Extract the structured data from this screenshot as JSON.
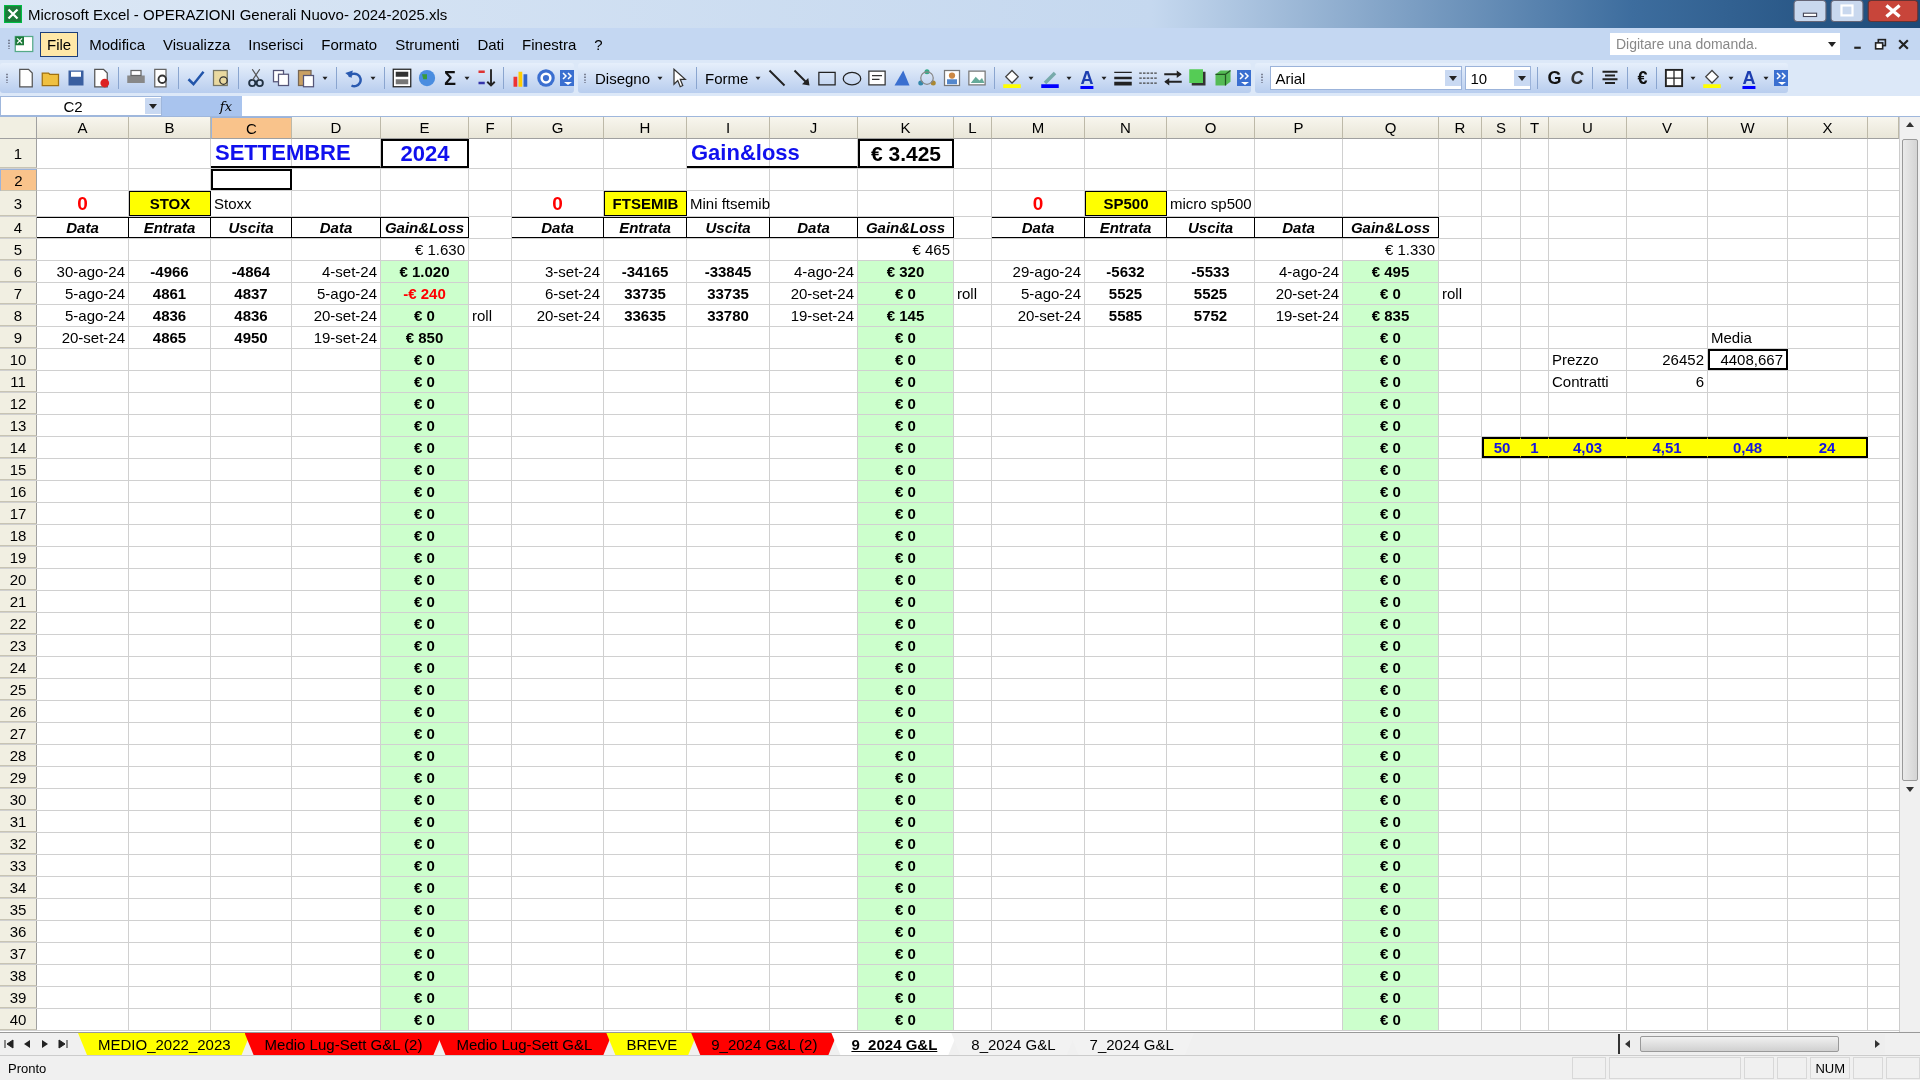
{
  "window": {
    "title": "Microsoft Excel - OPERAZIONI Generali Nuovo- 2024-2025.xls"
  },
  "menu": [
    {
      "label": "File",
      "selected": true
    },
    {
      "label": "Modifica",
      "selected": false
    },
    {
      "label": "Visualizza",
      "selected": false
    },
    {
      "label": "Inserisci",
      "selected": false
    },
    {
      "label": "Formato",
      "selected": false
    },
    {
      "label": "Strumenti",
      "selected": false
    },
    {
      "label": "Dati",
      "selected": false
    },
    {
      "label": "Finestra",
      "selected": false
    },
    {
      "label": "?",
      "selected": false
    }
  ],
  "help_search": {
    "placeholder": "Digitare una domanda."
  },
  "toolbar": {
    "sum": "Σ",
    "drawing": "Disegno",
    "shapes": "Forme",
    "drawing_font_color": "A",
    "font": "Arial",
    "size": "10",
    "bold": "G",
    "italic": "C",
    "euro": "€",
    "font_color": "A"
  },
  "formula_bar": {
    "name_box": "C2",
    "fx": "fx"
  },
  "sheet": {
    "columns": [
      {
        "label": "A",
        "selected": false
      },
      {
        "label": "B",
        "selected": false
      },
      {
        "label": "C",
        "selected": true
      },
      {
        "label": "D",
        "selected": false
      },
      {
        "label": "E",
        "selected": false
      },
      {
        "label": "F",
        "selected": false
      },
      {
        "label": "G",
        "selected": false
      },
      {
        "label": "H",
        "selected": false
      },
      {
        "label": "I",
        "selected": false
      },
      {
        "label": "J",
        "selected": false
      },
      {
        "label": "K",
        "selected": false
      },
      {
        "label": "L",
        "selected": false
      },
      {
        "label": "M",
        "selected": false
      },
      {
        "label": "N",
        "selected": false
      },
      {
        "label": "O",
        "selected": false
      },
      {
        "label": "P",
        "selected": false
      },
      {
        "label": "Q",
        "selected": false
      },
      {
        "label": "R",
        "selected": false
      },
      {
        "label": "S",
        "selected": false
      },
      {
        "label": "T",
        "selected": false
      },
      {
        "label": "U",
        "selected": false
      },
      {
        "label": "V",
        "selected": false
      },
      {
        "label": "W",
        "selected": false
      },
      {
        "label": "X",
        "selected": false
      }
    ],
    "rows": [
      {
        "n": "1",
        "selected": false,
        "cells": [
          {},
          {},
          {
            "kind": "title",
            "text": "SETTEMBRE"
          },
          {},
          {
            "kind": "year",
            "text": "2024"
          },
          {},
          {},
          {},
          {
            "kind": "title",
            "text": "Gain&loss"
          },
          {},
          {
            "kind": "grand-total",
            "text": "€ 3.425"
          }
        ]
      },
      {
        "n": "2",
        "selected": true,
        "cells": []
      },
      {
        "n": "3",
        "selected": false,
        "cells": [
          {
            "kind": "count",
            "text": "0"
          },
          {
            "kind": "ticker",
            "text": "STOX"
          },
          {
            "kind": "label",
            "text": "Stoxx"
          },
          {},
          {},
          {},
          {
            "kind": "count",
            "text": "0"
          },
          {
            "kind": "ticker",
            "text": "FTSEMIB"
          },
          {
            "kind": "label",
            "text": "Mini ftsemib"
          },
          {},
          {},
          {},
          {
            "kind": "count",
            "text": "0"
          },
          {
            "kind": "ticker",
            "text": "SP500"
          },
          {
            "kind": "label",
            "text": "micro sp500"
          }
        ]
      },
      {
        "n": "4",
        "selected": false,
        "cells": [
          {
            "kind": "col-head",
            "text": "Data"
          },
          {
            "kind": "col-head",
            "text": "Entrata"
          },
          {
            "kind": "col-head",
            "text": "Uscita"
          },
          {
            "kind": "col-head",
            "text": "Data"
          },
          {
            "kind": "col-head",
            "text": "Gain&Loss"
          },
          {},
          {
            "kind": "col-head",
            "text": "Data"
          },
          {
            "kind": "col-head",
            "text": "Entrata"
          },
          {
            "kind": "col-head",
            "text": "Uscita"
          },
          {
            "kind": "col-head",
            "text": "Data"
          },
          {
            "kind": "col-head",
            "text": "Gain&Loss"
          },
          {},
          {
            "kind": "col-head",
            "text": "Data"
          },
          {
            "kind": "col-head",
            "text": "Entrata"
          },
          {
            "kind": "col-head",
            "text": "Uscita"
          },
          {
            "kind": "col-head",
            "text": "Data"
          },
          {
            "kind": "col-head",
            "text": "Gain&Loss"
          }
        ]
      },
      {
        "n": "5",
        "selected": false,
        "cells": [
          {},
          {},
          {},
          {},
          {
            "kind": "sum",
            "text": "€ 1.630"
          },
          {},
          {},
          {},
          {},
          {},
          {
            "kind": "sum",
            "text": "€ 465"
          },
          {},
          {},
          {},
          {},
          {},
          {
            "kind": "sum",
            "text": "€ 1.330"
          }
        ]
      },
      {
        "n": "6",
        "selected": false,
        "cells": [
          {
            "kind": "date",
            "text": "30-ago-24"
          },
          {
            "kind": "num",
            "text": "-4966"
          },
          {
            "kind": "num",
            "text": "-4864"
          },
          {
            "kind": "date",
            "text": "4-set-24"
          },
          {
            "kind": "gl",
            "text": "€ 1.020"
          },
          {},
          {
            "kind": "date",
            "text": "3-set-24"
          },
          {
            "kind": "num",
            "text": "-34165"
          },
          {
            "kind": "num",
            "text": "-33845"
          },
          {
            "kind": "date",
            "text": "4-ago-24"
          },
          {
            "kind": "gl",
            "text": "€ 320"
          },
          {},
          {
            "kind": "date",
            "text": "29-ago-24"
          },
          {
            "kind": "num",
            "text": "-5632"
          },
          {
            "kind": "num",
            "text": "-5533"
          },
          {
            "kind": "date",
            "text": "4-ago-24"
          },
          {
            "kind": "gl",
            "text": "€ 495"
          }
        ]
      },
      {
        "n": "7",
        "selected": false,
        "cells": [
          {
            "kind": "date",
            "text": "5-ago-24"
          },
          {
            "kind": "num",
            "text": "4861"
          },
          {
            "kind": "num",
            "text": "4837"
          },
          {
            "kind": "date",
            "text": "5-ago-24"
          },
          {
            "kind": "gl-loss",
            "text": "-€ 240"
          },
          {},
          {
            "kind": "date",
            "text": "6-set-24"
          },
          {
            "kind": "num",
            "text": "33735"
          },
          {
            "kind": "num",
            "text": "33735"
          },
          {
            "kind": "date",
            "text": "20-set-24"
          },
          {
            "kind": "gl",
            "text": "€ 0"
          },
          {
            "kind": "label",
            "text": "roll"
          },
          {
            "kind": "date",
            "text": "5-ago-24"
          },
          {
            "kind": "num",
            "text": "5525"
          },
          {
            "kind": "num",
            "text": "5525"
          },
          {
            "kind": "date",
            "text": "20-set-24"
          },
          {
            "kind": "gl",
            "text": "€ 0"
          },
          {
            "kind": "label",
            "text": "roll"
          }
        ]
      },
      {
        "n": "8",
        "selected": false,
        "cells": [
          {
            "kind": "date",
            "text": "5-ago-24"
          },
          {
            "kind": "num",
            "text": "4836"
          },
          {
            "kind": "num",
            "text": "4836"
          },
          {
            "kind": "date",
            "text": "20-set-24"
          },
          {
            "kind": "gl",
            "text": "€ 0"
          },
          {
            "kind": "label",
            "text": "roll"
          },
          {
            "kind": "date",
            "text": "20-set-24"
          },
          {
            "kind": "num",
            "text": "33635"
          },
          {
            "kind": "num",
            "text": "33780"
          },
          {
            "kind": "date",
            "text": "19-set-24"
          },
          {
            "kind": "gl",
            "text": "€ 145"
          },
          {},
          {
            "kind": "date",
            "text": "20-set-24"
          },
          {
            "kind": "num",
            "text": "5585"
          },
          {
            "kind": "num",
            "text": "5752"
          },
          {
            "kind": "date",
            "text": "19-set-24"
          },
          {
            "kind": "gl",
            "text": "€ 835"
          }
        ]
      },
      {
        "n": "9",
        "selected": false,
        "cells": [
          {
            "kind": "date",
            "text": "20-set-24"
          },
          {
            "kind": "num",
            "text": "4865"
          },
          {
            "kind": "num",
            "text": "4950"
          },
          {
            "kind": "date",
            "text": "19-set-24"
          },
          {
            "kind": "gl",
            "text": "€ 850"
          },
          {},
          {},
          {},
          {},
          {},
          {
            "kind": "gl",
            "text": "€ 0"
          },
          {},
          {},
          {},
          {},
          {},
          {
            "kind": "gl",
            "text": "€ 0"
          },
          {},
          {},
          {},
          {},
          {},
          {
            "kind": "label",
            "text": "Media"
          }
        ]
      },
      {
        "n": "10",
        "selected": false,
        "cells": [
          {},
          {},
          {},
          {},
          {
            "kind": "gl",
            "text": "€ 0"
          },
          {},
          {},
          {},
          {},
          {},
          {
            "kind": "gl",
            "text": "€ 0"
          },
          {},
          {},
          {},
          {},
          {},
          {
            "kind": "gl",
            "text": "€ 0"
          },
          {},
          {},
          {},
          {
            "kind": "label",
            "text": "Prezzo"
          },
          {
            "kind": "value",
            "text": "26452"
          },
          {
            "kind": "boxed",
            "text": "4408,667"
          }
        ]
      },
      {
        "n": "11",
        "selected": false,
        "cells": [
          {},
          {},
          {},
          {},
          {
            "kind": "gl",
            "text": "€ 0"
          },
          {},
          {},
          {},
          {},
          {},
          {
            "kind": "gl",
            "text": "€ 0"
          },
          {},
          {},
          {},
          {},
          {},
          {
            "kind": "gl",
            "text": "€ 0"
          },
          {},
          {},
          {},
          {
            "kind": "label",
            "text": "Contratti"
          },
          {
            "kind": "value",
            "text": "6"
          }
        ]
      },
      {
        "n": "12",
        "selected": false,
        "cells": [
          {},
          {},
          {},
          {},
          {
            "kind": "gl",
            "text": "€ 0"
          },
          {},
          {},
          {},
          {},
          {},
          {
            "kind": "gl",
            "text": "€ 0"
          },
          {},
          {},
          {},
          {},
          {},
          {
            "kind": "gl",
            "text": "€ 0"
          }
        ]
      },
      {
        "n": "13",
        "selected": false,
        "cells": [
          {},
          {},
          {},
          {},
          {
            "kind": "gl",
            "text": "€ 0"
          },
          {},
          {},
          {},
          {},
          {},
          {
            "kind": "gl",
            "text": "€ 0"
          },
          {},
          {},
          {},
          {},
          {},
          {
            "kind": "gl",
            "text": "€ 0"
          }
        ]
      },
      {
        "n": "14",
        "selected": false,
        "cells": [
          {},
          {},
          {},
          {},
          {
            "kind": "gl",
            "text": "€ 0"
          },
          {},
          {},
          {},
          {},
          {},
          {
            "kind": "gl",
            "text": "€ 0"
          },
          {},
          {},
          {},
          {},
          {},
          {
            "kind": "gl",
            "text": "€ 0"
          },
          {},
          {
            "kind": "band",
            "text": "50"
          },
          {
            "kind": "band",
            "text": "1"
          },
          {
            "kind": "band",
            "text": "4,03"
          },
          {
            "kind": "band",
            "text": "4,51"
          },
          {
            "kind": "band",
            "text": "0,48"
          },
          {
            "kind": "band",
            "text": "24"
          }
        ]
      },
      {
        "n": "15",
        "selected": false,
        "cells": [
          {},
          {},
          {},
          {},
          {
            "kind": "gl",
            "text": "€ 0"
          },
          {},
          {},
          {},
          {},
          {},
          {
            "kind": "gl",
            "text": "€ 0"
          },
          {},
          {},
          {},
          {},
          {},
          {
            "kind": "gl",
            "text": "€ 0"
          }
        ]
      },
      {
        "n": "16",
        "selected": false,
        "cells": [
          {},
          {},
          {},
          {},
          {
            "kind": "gl",
            "text": "€ 0"
          },
          {},
          {},
          {},
          {},
          {},
          {
            "kind": "gl",
            "text": "€ 0"
          },
          {},
          {},
          {},
          {},
          {},
          {
            "kind": "gl",
            "text": "€ 0"
          }
        ]
      },
      {
        "n": "17",
        "selected": false,
        "cells": [
          {},
          {},
          {},
          {},
          {
            "kind": "gl",
            "text": "€ 0"
          },
          {},
          {},
          {},
          {},
          {},
          {
            "kind": "gl",
            "text": "€ 0"
          },
          {},
          {},
          {},
          {},
          {},
          {
            "kind": "gl",
            "text": "€ 0"
          }
        ]
      },
      {
        "n": "18",
        "selected": false,
        "cells": [
          {},
          {},
          {},
          {},
          {
            "kind": "gl",
            "text": "€ 0"
          },
          {},
          {},
          {},
          {},
          {},
          {
            "kind": "gl",
            "text": "€ 0"
          },
          {},
          {},
          {},
          {},
          {},
          {
            "kind": "gl",
            "text": "€ 0"
          }
        ]
      },
      {
        "n": "19",
        "selected": false,
        "cells": [
          {},
          {},
          {},
          {},
          {
            "kind": "gl",
            "text": "€ 0"
          },
          {},
          {},
          {},
          {},
          {},
          {
            "kind": "gl",
            "text": "€ 0"
          },
          {},
          {},
          {},
          {},
          {},
          {
            "kind": "gl",
            "text": "€ 0"
          }
        ]
      },
      {
        "n": "20",
        "selected": false,
        "cells": [
          {},
          {},
          {},
          {},
          {
            "kind": "gl",
            "text": "€ 0"
          },
          {},
          {},
          {},
          {},
          {},
          {
            "kind": "gl",
            "text": "€ 0"
          },
          {},
          {},
          {},
          {},
          {},
          {
            "kind": "gl",
            "text": "€ 0"
          }
        ]
      },
      {
        "n": "21",
        "selected": false,
        "cells": [
          {},
          {},
          {},
          {},
          {
            "kind": "gl",
            "text": "€ 0"
          },
          {},
          {},
          {},
          {},
          {},
          {
            "kind": "gl",
            "text": "€ 0"
          },
          {},
          {},
          {},
          {},
          {},
          {
            "kind": "gl",
            "text": "€ 0"
          }
        ]
      },
      {
        "n": "22",
        "selected": false,
        "cells": [
          {},
          {},
          {},
          {},
          {
            "kind": "gl",
            "text": "€ 0"
          },
          {},
          {},
          {},
          {},
          {},
          {
            "kind": "gl",
            "text": "€ 0"
          },
          {},
          {},
          {},
          {},
          {},
          {
            "kind": "gl",
            "text": "€ 0"
          }
        ]
      },
      {
        "n": "23",
        "selected": false,
        "cells": [
          {},
          {},
          {},
          {},
          {
            "kind": "gl",
            "text": "€ 0"
          },
          {},
          {},
          {},
          {},
          {},
          {
            "kind": "gl",
            "text": "€ 0"
          },
          {},
          {},
          {},
          {},
          {},
          {
            "kind": "gl",
            "text": "€ 0"
          }
        ]
      },
      {
        "n": "24",
        "selected": false,
        "cells": [
          {},
          {},
          {},
          {},
          {
            "kind": "gl",
            "text": "€ 0"
          },
          {},
          {},
          {},
          {},
          {},
          {
            "kind": "gl",
            "text": "€ 0"
          },
          {},
          {},
          {},
          {},
          {},
          {
            "kind": "gl",
            "text": "€ 0"
          }
        ]
      },
      {
        "n": "25",
        "selected": false,
        "cells": [
          {},
          {},
          {},
          {},
          {
            "kind": "gl",
            "text": "€ 0"
          },
          {},
          {},
          {},
          {},
          {},
          {
            "kind": "gl",
            "text": "€ 0"
          },
          {},
          {},
          {},
          {},
          {},
          {
            "kind": "gl",
            "text": "€ 0"
          }
        ]
      },
      {
        "n": "26",
        "selected": false,
        "cells": [
          {},
          {},
          {},
          {},
          {
            "kind": "gl",
            "text": "€ 0"
          },
          {},
          {},
          {},
          {},
          {},
          {
            "kind": "gl",
            "text": "€ 0"
          },
          {},
          {},
          {},
          {},
          {},
          {
            "kind": "gl",
            "text": "€ 0"
          }
        ]
      },
      {
        "n": "27",
        "selected": false,
        "cells": [
          {},
          {},
          {},
          {},
          {
            "kind": "gl",
            "text": "€ 0"
          },
          {},
          {},
          {},
          {},
          {},
          {
            "kind": "gl",
            "text": "€ 0"
          },
          {},
          {},
          {},
          {},
          {},
          {
            "kind": "gl",
            "text": "€ 0"
          }
        ]
      },
      {
        "n": "28",
        "selected": false,
        "cells": [
          {},
          {},
          {},
          {},
          {
            "kind": "gl",
            "text": "€ 0"
          },
          {},
          {},
          {},
          {},
          {},
          {
            "kind": "gl",
            "text": "€ 0"
          },
          {},
          {},
          {},
          {},
          {},
          {
            "kind": "gl",
            "text": "€ 0"
          }
        ]
      },
      {
        "n": "29",
        "selected": false,
        "cells": [
          {},
          {},
          {},
          {},
          {
            "kind": "gl",
            "text": "€ 0"
          },
          {},
          {},
          {},
          {},
          {},
          {
            "kind": "gl",
            "text": "€ 0"
          },
          {},
          {},
          {},
          {},
          {},
          {
            "kind": "gl",
            "text": "€ 0"
          }
        ]
      },
      {
        "n": "30",
        "selected": false,
        "cells": [
          {},
          {},
          {},
          {},
          {
            "kind": "gl",
            "text": "€ 0"
          },
          {},
          {},
          {},
          {},
          {},
          {
            "kind": "gl",
            "text": "€ 0"
          },
          {},
          {},
          {},
          {},
          {},
          {
            "kind": "gl",
            "text": "€ 0"
          }
        ]
      },
      {
        "n": "31",
        "selected": false,
        "cells": [
          {},
          {},
          {},
          {},
          {
            "kind": "gl",
            "text": "€ 0"
          },
          {},
          {},
          {},
          {},
          {},
          {
            "kind": "gl",
            "text": "€ 0"
          },
          {},
          {},
          {},
          {},
          {},
          {
            "kind": "gl",
            "text": "€ 0"
          }
        ]
      },
      {
        "n": "32",
        "selected": false,
        "cells": [
          {},
          {},
          {},
          {},
          {
            "kind": "gl",
            "text": "€ 0"
          },
          {},
          {},
          {},
          {},
          {},
          {
            "kind": "gl",
            "text": "€ 0"
          },
          {},
          {},
          {},
          {},
          {},
          {
            "kind": "gl",
            "text": "€ 0"
          }
        ]
      },
      {
        "n": "33",
        "selected": false,
        "cells": [
          {},
          {},
          {},
          {},
          {
            "kind": "gl",
            "text": "€ 0"
          },
          {},
          {},
          {},
          {},
          {},
          {
            "kind": "gl",
            "text": "€ 0"
          },
          {},
          {},
          {},
          {},
          {},
          {
            "kind": "gl",
            "text": "€ 0"
          }
        ]
      },
      {
        "n": "34",
        "selected": false,
        "cells": [
          {},
          {},
          {},
          {},
          {
            "kind": "gl",
            "text": "€ 0"
          },
          {},
          {},
          {},
          {},
          {},
          {
            "kind": "gl",
            "text": "€ 0"
          },
          {},
          {},
          {},
          {},
          {},
          {
            "kind": "gl",
            "text": "€ 0"
          }
        ]
      },
      {
        "n": "35",
        "selected": false,
        "cells": [
          {},
          {},
          {},
          {},
          {
            "kind": "gl",
            "text": "€ 0"
          },
          {},
          {},
          {},
          {},
          {},
          {
            "kind": "gl",
            "text": "€ 0"
          },
          {},
          {},
          {},
          {},
          {},
          {
            "kind": "gl",
            "text": "€ 0"
          }
        ]
      },
      {
        "n": "36",
        "selected": false,
        "cells": [
          {},
          {},
          {},
          {},
          {
            "kind": "gl",
            "text": "€ 0"
          },
          {},
          {},
          {},
          {},
          {},
          {
            "kind": "gl",
            "text": "€ 0"
          },
          {},
          {},
          {},
          {},
          {},
          {
            "kind": "gl",
            "text": "€ 0"
          }
        ]
      },
      {
        "n": "37",
        "selected": false,
        "cells": [
          {},
          {},
          {},
          {},
          {
            "kind": "gl",
            "text": "€ 0"
          },
          {},
          {},
          {},
          {},
          {},
          {
            "kind": "gl",
            "text": "€ 0"
          },
          {},
          {},
          {},
          {},
          {},
          {
            "kind": "gl",
            "text": "€ 0"
          }
        ]
      },
      {
        "n": "38",
        "selected": false,
        "cells": [
          {},
          {},
          {},
          {},
          {
            "kind": "gl",
            "text": "€ 0"
          },
          {},
          {},
          {},
          {},
          {},
          {
            "kind": "gl",
            "text": "€ 0"
          },
          {},
          {},
          {},
          {},
          {},
          {
            "kind": "gl",
            "text": "€ 0"
          }
        ]
      },
      {
        "n": "39",
        "selected": false,
        "cells": [
          {},
          {},
          {},
          {},
          {
            "kind": "gl",
            "text": "€ 0"
          },
          {},
          {},
          {},
          {},
          {},
          {
            "kind": "gl",
            "text": "€ 0"
          },
          {},
          {},
          {},
          {},
          {},
          {
            "kind": "gl",
            "text": "€ 0"
          }
        ]
      },
      {
        "n": "40",
        "selected": false,
        "cells": [
          {},
          {},
          {},
          {},
          {
            "kind": "gl",
            "text": "€ 0"
          },
          {},
          {},
          {},
          {},
          {},
          {
            "kind": "gl",
            "text": "€ 0"
          },
          {},
          {},
          {},
          {},
          {},
          {
            "kind": "gl",
            "text": "€ 0"
          }
        ]
      }
    ]
  },
  "tabs": [
    {
      "label": "MEDIO_2022_2023",
      "color": "#ffff00",
      "selected": false
    },
    {
      "label": "Medio Lug-Sett G&L  (2)",
      "color": "#ff0000",
      "selected": false
    },
    {
      "label": "Medio Lug-Sett G&L",
      "color": "#ff0000",
      "selected": false
    },
    {
      "label": "BREVE",
      "color": "#ffff00",
      "selected": false
    },
    {
      "label": "9_2024 G&L  (2)",
      "color": "#ff0000",
      "selected": false
    },
    {
      "label": "9_2024 G&L",
      "selected": true
    },
    {
      "label": "8_2024 G&L",
      "selected": false
    },
    {
      "label": "7_2024 G&L",
      "selected": false
    }
  ],
  "status_bar": {
    "text": "Pronto",
    "num": "NUM"
  }
}
